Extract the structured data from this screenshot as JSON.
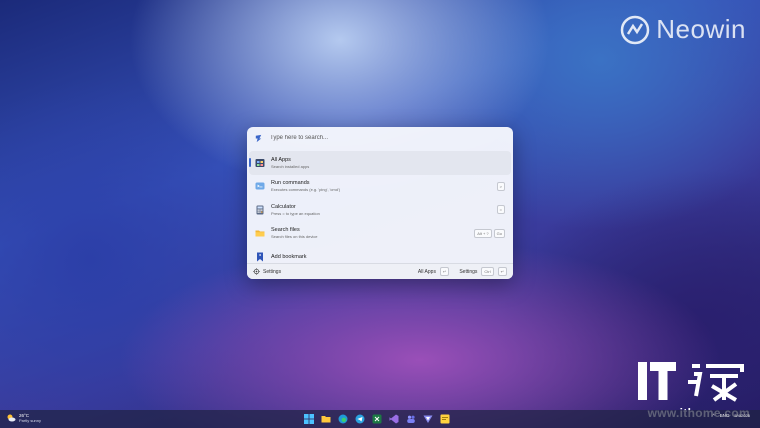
{
  "watermarks": {
    "neowin": "Neowin",
    "ithome_url": "www.ithome.com"
  },
  "launcher": {
    "search": {
      "placeholder": "Type here to search..."
    },
    "results": [
      {
        "title": "All Apps",
        "subtitle": "Search installed apps",
        "icon": "all-apps-icon",
        "selected": true,
        "shortcut": []
      },
      {
        "title": "Run commands",
        "subtitle": "Executes commands (e.g. 'ping', 'cmd')",
        "icon": "run-command-icon",
        "selected": false,
        "shortcut": [
          ">"
        ]
      },
      {
        "title": "Calculator",
        "subtitle": "Press = to type an equation",
        "icon": "calculator-icon",
        "selected": false,
        "shortcut": [
          "="
        ]
      },
      {
        "title": "Search files",
        "subtitle": "Search files on this device",
        "icon": "folder-icon",
        "selected": false,
        "shortcut": [
          "Alt + ?",
          "Go"
        ]
      },
      {
        "title": "Add bookmark",
        "subtitle": "",
        "icon": "bookmark-icon",
        "selected": false,
        "shortcut": []
      }
    ],
    "footer": {
      "settings_label": "Settings",
      "primary_action": "All Apps",
      "primary_key": "↵",
      "secondary_action": "Settings",
      "secondary_keys": [
        "Ctrl",
        "↵"
      ]
    }
  },
  "taskbar": {
    "weather": {
      "temp": "26°C",
      "desc": "Partly sunny"
    },
    "pinned": [
      "windows-start-icon",
      "file-explorer-icon",
      "edge-icon",
      "telegram-icon",
      "excel-icon",
      "visual-studio-icon",
      "teams-icon",
      "vivaldi-icon",
      "sticky-notes-icon"
    ],
    "tray": {
      "language": "ENG",
      "date": "5/4/2025"
    }
  },
  "colors": {
    "accent": "#3b66c9",
    "panel": "#f4f6fc"
  }
}
